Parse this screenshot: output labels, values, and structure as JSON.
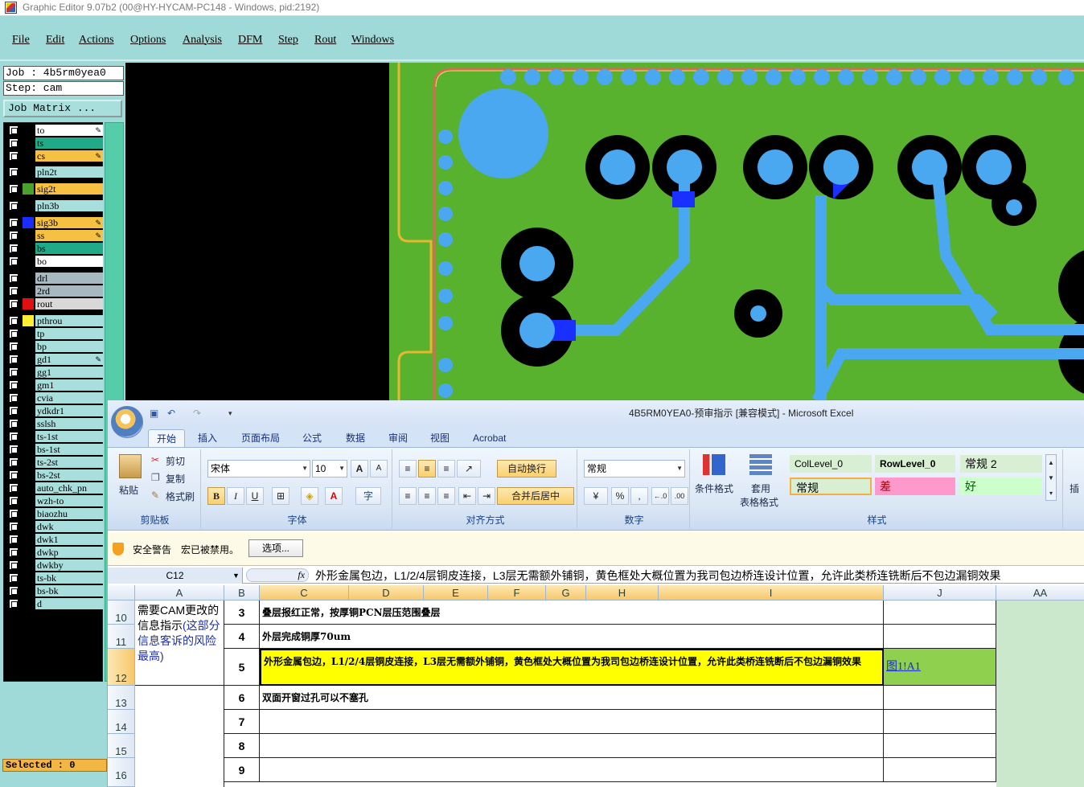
{
  "window": {
    "title": "Graphic Editor 9.07b2 (00@HY-HYCAM-PC148 - Windows, pid:2192)"
  },
  "menu": [
    "File",
    "Edit",
    "Actions",
    "Options",
    "Analysis",
    "DFM",
    "Step",
    "Rout",
    "Windows"
  ],
  "job": {
    "job_line": "Job : 4b5rm0yea0",
    "step_line": "Step: cam",
    "matrix_button": "Job Matrix ..."
  },
  "layers": [
    {
      "name": "to",
      "bg": "#ffffff",
      "swatch": "#000000",
      "edit": true
    },
    {
      "name": "ts",
      "bg": "#1faa88",
      "swatch": "#000000",
      "edit": false
    },
    {
      "name": "cs",
      "bg": "#f6c043",
      "swatch": "#000000",
      "edit": true
    },
    {
      "name": "pln2t",
      "bg": "#a8dedc",
      "swatch": "#000000",
      "edit": false
    },
    {
      "name": "sig2t",
      "bg": "#f6c043",
      "swatch": "#4aa02c",
      "edit": false
    },
    {
      "name": "pln3b",
      "bg": "#a8dedc",
      "swatch": "#000000",
      "edit": false
    },
    {
      "name": "sig3b",
      "bg": "#f6c043",
      "swatch": "#1a2cff",
      "edit": true
    },
    {
      "name": "ss",
      "bg": "#f6c043",
      "swatch": "#000000",
      "edit": true
    },
    {
      "name": "bs",
      "bg": "#1faa88",
      "swatch": "#000000",
      "edit": false
    },
    {
      "name": "bo",
      "bg": "#ffffff",
      "swatch": "#000000",
      "edit": false
    },
    {
      "name": "drl",
      "bg": "#a8b8c0",
      "swatch": "#000000",
      "edit": false
    },
    {
      "name": "2rd",
      "bg": "#a8b8c0",
      "swatch": "#000000",
      "edit": false
    },
    {
      "name": "rout",
      "bg": "#d8d8d8",
      "swatch": "#e01010",
      "edit": false
    },
    {
      "name": "pthrou",
      "bg": "#a8dedc",
      "swatch": "#ffee33",
      "edit": false
    },
    {
      "name": "tp",
      "bg": "#a8dedc",
      "swatch": "#000000",
      "edit": false
    },
    {
      "name": "bp",
      "bg": "#a8dedc",
      "swatch": "#000000",
      "edit": false
    },
    {
      "name": "gd1",
      "bg": "#a8dedc",
      "swatch": "#000000",
      "edit": true
    },
    {
      "name": "gg1",
      "bg": "#a8dedc",
      "swatch": "#000000",
      "edit": false
    },
    {
      "name": "gm1",
      "bg": "#a8dedc",
      "swatch": "#000000",
      "edit": false
    },
    {
      "name": "cvia",
      "bg": "#a8dedc",
      "swatch": "#000000",
      "edit": false
    },
    {
      "name": "ydkdr1",
      "bg": "#a8dedc",
      "swatch": "#000000",
      "edit": false
    },
    {
      "name": "sslsh",
      "bg": "#a8dedc",
      "swatch": "#000000",
      "edit": false
    },
    {
      "name": "ts-1st",
      "bg": "#a8dedc",
      "swatch": "#000000",
      "edit": false
    },
    {
      "name": "bs-1st",
      "bg": "#a8dedc",
      "swatch": "#000000",
      "edit": false
    },
    {
      "name": "ts-2st",
      "bg": "#a8dedc",
      "swatch": "#000000",
      "edit": false
    },
    {
      "name": "bs-2st",
      "bg": "#a8dedc",
      "swatch": "#000000",
      "edit": false
    },
    {
      "name": "auto_chk_pn",
      "bg": "#a8dedc",
      "swatch": "#000000",
      "edit": false
    },
    {
      "name": "wzh-to",
      "bg": "#a8dedc",
      "swatch": "#000000",
      "edit": false
    },
    {
      "name": "biaozhu",
      "bg": "#a8dedc",
      "swatch": "#000000",
      "edit": false
    },
    {
      "name": "dwk",
      "bg": "#a8dedc",
      "swatch": "#000000",
      "edit": false
    },
    {
      "name": "dwk1",
      "bg": "#a8dedc",
      "swatch": "#000000",
      "edit": false
    },
    {
      "name": "dwkp",
      "bg": "#a8dedc",
      "swatch": "#000000",
      "edit": false
    },
    {
      "name": "dwkby",
      "bg": "#a8dedc",
      "swatch": "#000000",
      "edit": false
    },
    {
      "name": "ts-bk",
      "bg": "#a8dedc",
      "swatch": "#000000",
      "edit": false
    },
    {
      "name": "bs-bk",
      "bg": "#a8dedc",
      "swatch": "#000000",
      "edit": false
    },
    {
      "name": "d",
      "bg": "#a8dedc",
      "swatch": "#000000",
      "edit": false
    }
  ],
  "status": {
    "selected": "Selected : 0"
  },
  "excel": {
    "title": "4B5RM0YEA0-预审指示  [兼容模式] - Microsoft Excel",
    "tabs": [
      "开始",
      "插入",
      "页面布局",
      "公式",
      "数据",
      "审阅",
      "视图",
      "Acrobat"
    ],
    "clipboard": {
      "paste": "粘贴",
      "cut": "剪切",
      "copy": "复制",
      "format_painter": "格式刷",
      "label": "剪贴板"
    },
    "font": {
      "name": "宋体",
      "size": "10",
      "label": "字体",
      "bold": "B",
      "italic": "I",
      "underline": "U",
      "grow": "A",
      "shrink": "A",
      "color": "A"
    },
    "alignment": {
      "wrap": "自动换行",
      "merge": "合并后居中",
      "label": "对齐方式"
    },
    "number": {
      "format": "常规",
      "percent": "%",
      "comma": ",",
      "label": "数字"
    },
    "styles": {
      "cond_format": "条件格式",
      "table_format_1": "套用",
      "table_format_2": "表格格式",
      "label": "样式",
      "items": [
        {
          "text": "ColLevel_0",
          "bg": "#d9efd4",
          "bold": false
        },
        {
          "text": "RowLevel_0",
          "bg": "#d9efd4",
          "bold": true
        },
        {
          "text": "常规 2",
          "bg": "#d9efd4",
          "bold": false
        },
        {
          "text": "常规",
          "bg": "#d9efd4",
          "bold": false
        },
        {
          "text": "差",
          "bg": "#ff99cc",
          "bold": false
        },
        {
          "text": "好",
          "bg": "#ccffcc",
          "bold": false
        }
      ]
    },
    "insert_group": "插",
    "security": {
      "warning": "安全警告",
      "message": "宏已被禁用。",
      "options": "选项..."
    },
    "name_box": "C12",
    "fx": "fx",
    "formula": "外形金属包边，L1/2/4层铜皮连接，L3层无需额外铺铜，黄色框处大概位置为我司包边桥连设计位置，允许此类桥连铣断后不包边漏铜效果",
    "columns": [
      "A",
      "B",
      "C",
      "D",
      "E",
      "F",
      "G",
      "H",
      "I",
      "J",
      "AA"
    ],
    "note": "需要CAM更改的信息指示",
    "note_extra": "(这部分信息客诉的风险最高)",
    "rows": [
      {
        "row": "10",
        "num": "3",
        "text": "叠层报红正常，按厚铜PCN层压范围叠层"
      },
      {
        "row": "11",
        "num": "4",
        "text": "外层完成铜厚70um"
      },
      {
        "row": "12",
        "num": "5",
        "text": "外形金属包边，L1/2/4层铜皮连接，L3层无需额外铺铜，黄色框处大概位置为我司包边桥连设计位置，允许此类桥连铣断后不包边漏铜效果",
        "link": "图1!A1"
      },
      {
        "row": "13",
        "num": "6",
        "text": "双面开窗过孔可以不塞孔"
      },
      {
        "row": "14",
        "num": "7",
        "text": ""
      },
      {
        "row": "15",
        "num": "8",
        "text": ""
      },
      {
        "row": "16",
        "num": "9",
        "text": ""
      }
    ]
  }
}
